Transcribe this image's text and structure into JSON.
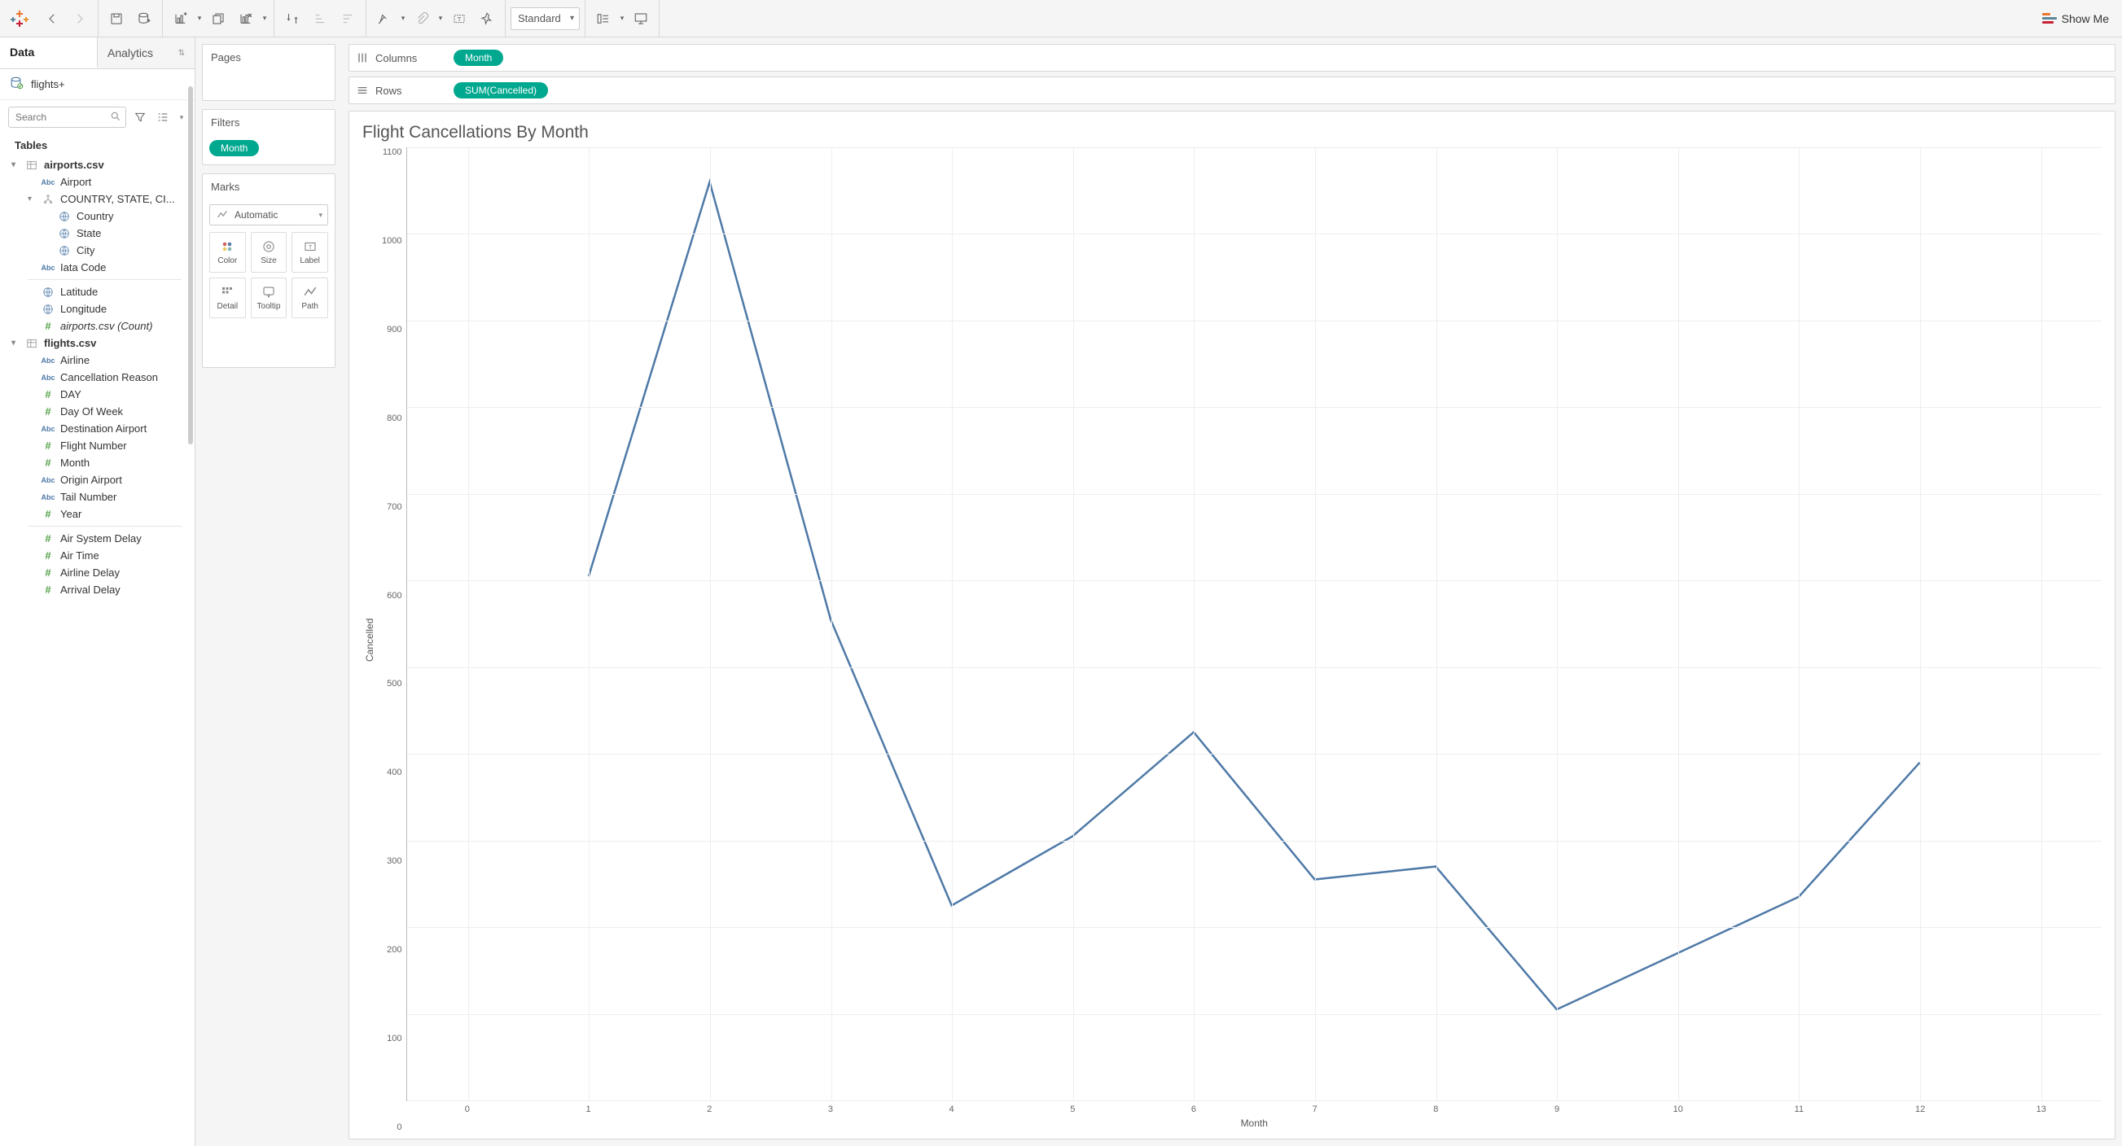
{
  "toolbar": {
    "view_mode": "Standard",
    "show_me": "Show Me"
  },
  "left": {
    "tab_data": "Data",
    "tab_analytics": "Analytics",
    "datasource": "flights+",
    "search_placeholder": "Search",
    "tables_header": "Tables",
    "tables": [
      {
        "name": "airports.csv",
        "expanded": true,
        "fields": [
          {
            "name": "Airport",
            "type": "abc"
          },
          {
            "name": "COUNTRY, STATE, CI...",
            "type": "hier",
            "expanded": true,
            "children": [
              {
                "name": "Country",
                "type": "globe"
              },
              {
                "name": "State",
                "type": "globe"
              },
              {
                "name": "City",
                "type": "globe"
              }
            ]
          },
          {
            "name": "Iata Code",
            "type": "abc"
          },
          {
            "name": "Latitude",
            "type": "globe",
            "sep": true
          },
          {
            "name": "Longitude",
            "type": "globe"
          },
          {
            "name": "airports.csv (Count)",
            "type": "hash",
            "italic": true
          }
        ]
      },
      {
        "name": "flights.csv",
        "expanded": true,
        "fields": [
          {
            "name": "Airline",
            "type": "abc"
          },
          {
            "name": "Cancellation Reason",
            "type": "abc"
          },
          {
            "name": "DAY",
            "type": "hash"
          },
          {
            "name": "Day Of Week",
            "type": "hash"
          },
          {
            "name": "Destination Airport",
            "type": "abc"
          },
          {
            "name": "Flight Number",
            "type": "hash"
          },
          {
            "name": "Month",
            "type": "hash"
          },
          {
            "name": "Origin Airport",
            "type": "abc"
          },
          {
            "name": "Tail Number",
            "type": "abc"
          },
          {
            "name": "Year",
            "type": "hash"
          },
          {
            "name": "Air System Delay",
            "type": "hash",
            "sep": true
          },
          {
            "name": "Air Time",
            "type": "hash"
          },
          {
            "name": "Airline Delay",
            "type": "hash"
          },
          {
            "name": "Arrival Delay",
            "type": "hash"
          }
        ]
      }
    ]
  },
  "mid": {
    "pages_title": "Pages",
    "filters_title": "Filters",
    "filter_pill": "Month",
    "marks_title": "Marks",
    "mark_type": "Automatic",
    "cells": {
      "color": "Color",
      "size": "Size",
      "label": "Label",
      "detail": "Detail",
      "tooltip": "Tooltip",
      "path": "Path"
    }
  },
  "shelves": {
    "columns_label": "Columns",
    "columns_pill": "Month",
    "rows_label": "Rows",
    "rows_pill": "SUM(Cancelled)"
  },
  "chart_data": {
    "type": "line",
    "title": "Flight Cancellations By Month",
    "xlabel": "Month",
    "ylabel": "Cancelled",
    "x_ticks": [
      0,
      1,
      2,
      3,
      4,
      5,
      6,
      7,
      8,
      9,
      10,
      11,
      12,
      13
    ],
    "y_ticks": [
      1100,
      1000,
      900,
      800,
      700,
      600,
      500,
      400,
      300,
      200,
      100,
      0
    ],
    "xlim": [
      0,
      13
    ],
    "ylim": [
      0,
      1100
    ],
    "series": [
      {
        "name": "Cancelled",
        "x": [
          1,
          2,
          3,
          4,
          5,
          6,
          7,
          8,
          9,
          10,
          11,
          12
        ],
        "values": [
          605,
          1060,
          555,
          225,
          305,
          425,
          255,
          270,
          105,
          170,
          235,
          390
        ]
      }
    ]
  }
}
